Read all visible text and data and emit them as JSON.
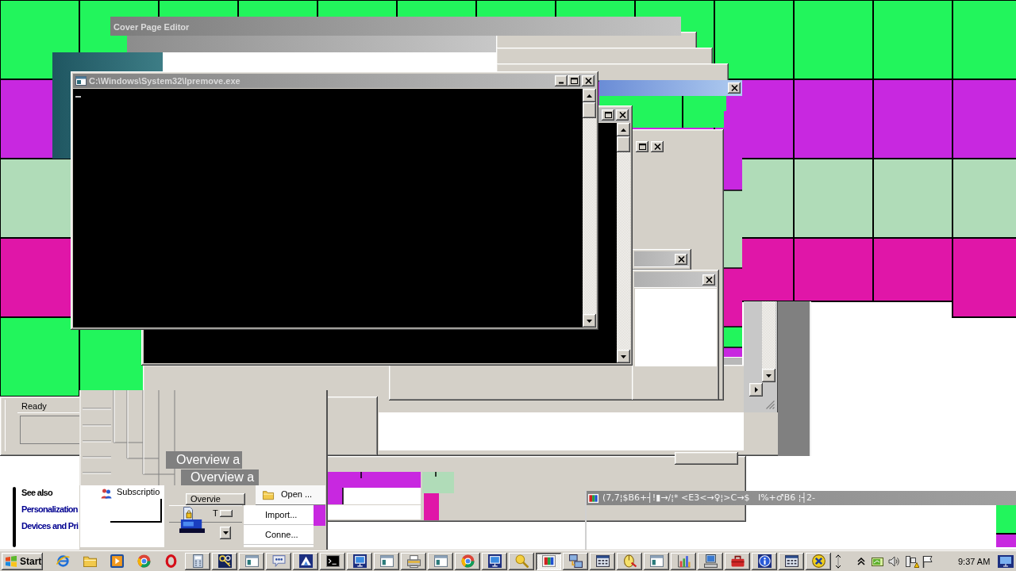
{
  "cover_page_editor": {
    "title": "Cover Page Editor"
  },
  "console_window": {
    "title": "C:\\Windows\\System32\\lpremove.exe"
  },
  "status_bar": {
    "text": "Ready"
  },
  "overview_windows": [
    {
      "title": "Overview a"
    },
    {
      "title": "Overview a"
    }
  ],
  "subscriptions_list": {
    "label": "Subscriptio"
  },
  "overview_button": {
    "label": "Overvie"
  },
  "task_row": {
    "label": "T"
  },
  "open_item": {
    "label": "Open ..."
  },
  "actions": [
    {
      "label": "Import..."
    },
    {
      "label": "Conne..."
    }
  ],
  "see_also": {
    "heading": "See also",
    "links": [
      "Personalization",
      "Devices and Pri"
    ]
  },
  "glitched_window": {
    "title": "(7,7¦$B6+┤!▮→/¦* <E3<→♀¦>C→$   I%+♂B6 ¦┤2-"
  },
  "taskbar": {
    "start": "Start",
    "buttons": [
      {
        "kind": "launch",
        "selected": false
      },
      {
        "kind": "launch",
        "selected": false
      },
      {
        "kind": "launch",
        "selected": false
      },
      {
        "kind": "launch",
        "selected": false
      },
      {
        "kind": "launch",
        "selected": false
      },
      {
        "kind": "task",
        "selected": false
      },
      {
        "kind": "task",
        "selected": false
      },
      {
        "kind": "task",
        "selected": false
      },
      {
        "kind": "task",
        "selected": false
      },
      {
        "kind": "task",
        "selected": false
      },
      {
        "kind": "task",
        "selected": false
      },
      {
        "kind": "task",
        "selected": false
      },
      {
        "kind": "task",
        "selected": false
      },
      {
        "kind": "task",
        "selected": false
      },
      {
        "kind": "task",
        "selected": false
      },
      {
        "kind": "task",
        "selected": false
      },
      {
        "kind": "task",
        "selected": false
      },
      {
        "kind": "task",
        "selected": false
      },
      {
        "kind": "task",
        "selected": true
      },
      {
        "kind": "task",
        "selected": false
      },
      {
        "kind": "task",
        "selected": false
      },
      {
        "kind": "task",
        "selected": false
      },
      {
        "kind": "task",
        "selected": false
      },
      {
        "kind": "task",
        "selected": false
      },
      {
        "kind": "task",
        "selected": false
      },
      {
        "kind": "task",
        "selected": false
      },
      {
        "kind": "task",
        "selected": false
      },
      {
        "kind": "task",
        "selected": false
      },
      {
        "kind": "task",
        "selected": false
      }
    ],
    "clock": "9:37 AM"
  }
}
